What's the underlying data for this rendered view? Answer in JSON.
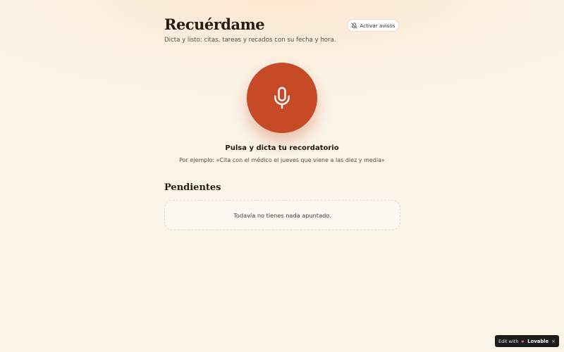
{
  "header": {
    "title": "Recuérdame",
    "subtitle": "Dicta y listo: citas, tareas y recados con su fecha y hora.",
    "notify_button_label": "Activar avisos",
    "notify_icon": "bell-off-icon"
  },
  "recorder": {
    "mic_icon": "microphone-icon",
    "mic_color": "#c54a25",
    "prompt": "Pulsa y dicta tu recordatorio",
    "example": "Por ejemplo: «Cita con el médico el jueves que viene a las diez y media»"
  },
  "pending": {
    "title": "Pendientes",
    "empty_message": "Todavía no tienes nada apuntado."
  },
  "badge": {
    "edit_label": "Edit with",
    "brand": "Lovable",
    "close": "×",
    "brand_icon": "heart-icon"
  },
  "colors": {
    "accent": "#c54a25",
    "background": "#fbf5ea",
    "text": "#2a1a12"
  }
}
